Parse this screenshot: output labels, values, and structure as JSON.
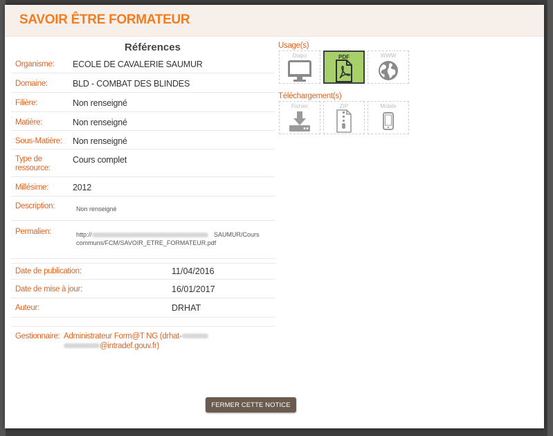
{
  "modal": {
    "title": "SAVOIR ÊTRE FORMATEUR",
    "close_button": "FERMER CETTE NOTICE"
  },
  "references": {
    "heading": "Références",
    "rows": [
      {
        "label": "Organisme:",
        "value": "ECOLE DE CAVALERIE SAUMUR"
      },
      {
        "label": "Domaine:",
        "value": "BLD - COMBAT DES BLINDES"
      },
      {
        "label": "Filière:",
        "value": "Non renseigné"
      },
      {
        "label": "Matière:",
        "value": "Non renseigné"
      },
      {
        "label": "Sous-Matière:",
        "value": "Non renseigné"
      },
      {
        "label1": "Type de",
        "label2": "ressource:",
        "value": "Cours complet"
      },
      {
        "label": "Millésime:",
        "value": "2012"
      },
      {
        "label": "Description:",
        "value": "Non renseigné"
      },
      {
        "label": "Permalien:",
        "value_prefix": "http://",
        "value_suffix": "SAUMUR/Cours",
        "value_line2": "communs/FCM/SAVOIR_ETRE_FORMATEUR.pdf"
      }
    ],
    "dates": [
      {
        "label": "Date de publication:",
        "value": "11/04/2016"
      },
      {
        "label": "Date de mise à jour:",
        "value": "16/01/2017"
      },
      {
        "label": "Auteur:",
        "value": "DRHAT"
      }
    ],
    "gestionnaire": {
      "label": "Gestionnaire:",
      "line1": "Administrateur Form@T NG (drhat-",
      "line2": "@intradef.gouv.fr)"
    }
  },
  "usage": {
    "label": "Usage(s)",
    "tiles": [
      {
        "label": "Diapo",
        "icon": "monitor-icon",
        "active": false
      },
      {
        "label": "PDF",
        "icon": "pdf-icon",
        "active": true
      },
      {
        "label": "WWW",
        "icon": "globe-icon",
        "active": false
      }
    ]
  },
  "download": {
    "label": "Téléchargement(s)",
    "tiles": [
      {
        "label": "Fichier",
        "icon": "download-icon"
      },
      {
        "label": "ZIP",
        "icon": "zip-file-icon"
      },
      {
        "label": "Mobile",
        "icon": "mobile-icon"
      }
    ]
  },
  "colors": {
    "accent": "#ef7d22",
    "label": "#e0631f",
    "active_tile": "#a7cf6a",
    "button": "#6b5a4e"
  }
}
